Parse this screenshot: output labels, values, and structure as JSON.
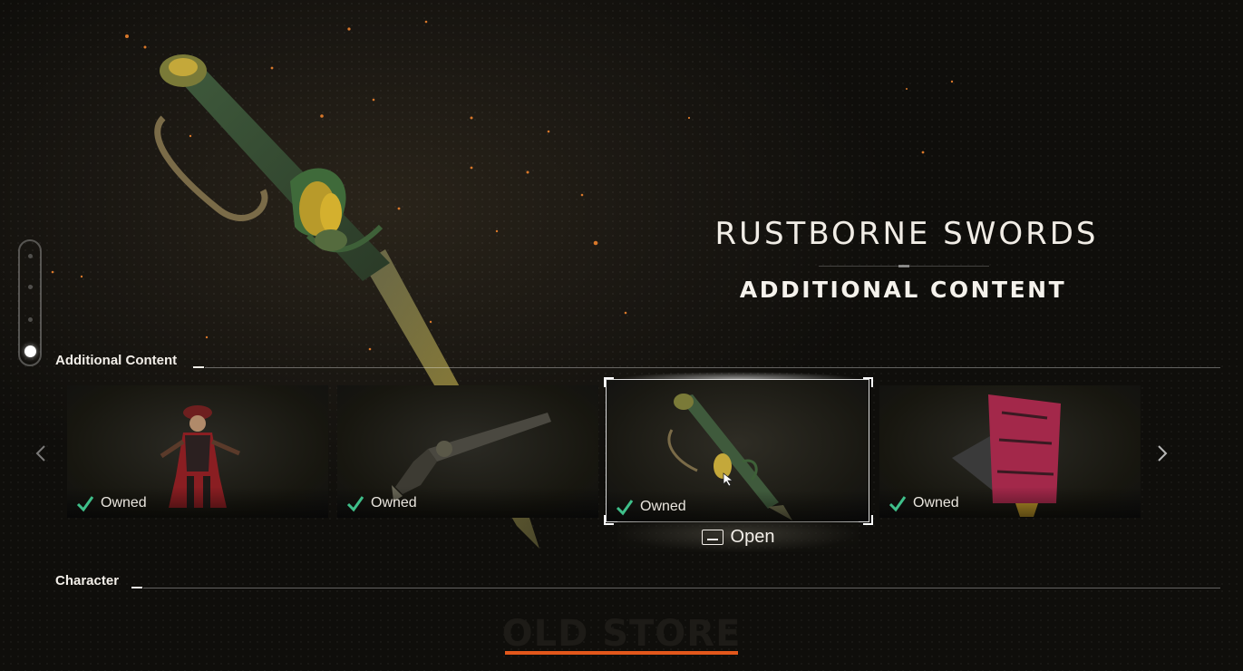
{
  "hero": {
    "title": "RUSTBORNE SWORDS",
    "subtitle": "ADDITIONAL CONTENT"
  },
  "page_indicator": {
    "count": 4,
    "active_index": 3
  },
  "sections": {
    "additional_content": "Additional Content",
    "character": "Character"
  },
  "carousel": {
    "items": [
      {
        "status": "Owned",
        "icon": "pirate-character"
      },
      {
        "status": "Owned",
        "icon": "flintlock-pistol"
      },
      {
        "status": "Owned",
        "icon": "rustborne-sword",
        "selected": true
      },
      {
        "status": "Owned",
        "icon": "red-sails-ship"
      }
    ],
    "open_label": "Open",
    "prev_icon": "chevron-left-icon",
    "next_icon": "chevron-right-icon"
  },
  "bottom_tab": {
    "label": "OLD STORE"
  },
  "colors": {
    "accent": "#e2571b",
    "check": "#3fbf8a"
  }
}
